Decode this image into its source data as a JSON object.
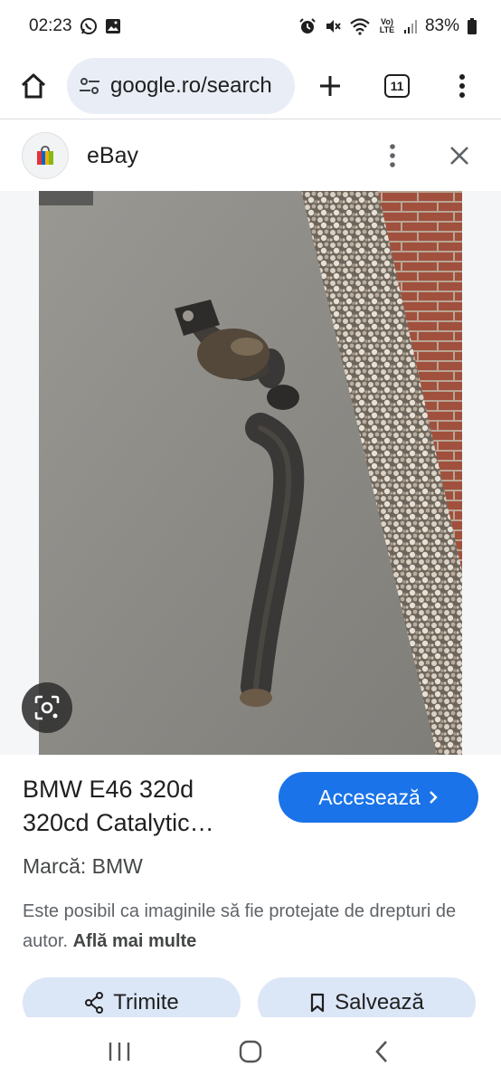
{
  "status_bar": {
    "time": "02:23",
    "battery": "83%",
    "net_label": "Vo) LTE"
  },
  "browser": {
    "url": "google.ro/search",
    "tab_count": "11"
  },
  "sheet": {
    "site_name": "eBay"
  },
  "product": {
    "title": "BMW E46 320d 320cd Catalytic…",
    "visit_label": "Accesează",
    "brand": "Marcă: BMW",
    "copyright_text": "Este posibil ca imaginile să fie protejate de drepturi de autor. ",
    "learn_more": "Află mai multe",
    "share_label": "Trimite",
    "save_label": "Salvează"
  },
  "colors": {
    "accent": "#1a73e8",
    "chip_bg": "#dbe6f7",
    "url_bg": "#e9edf5"
  },
  "icons": [
    "home-icon",
    "tune-icon",
    "plus-icon",
    "tabs-icon",
    "more-vert-icon",
    "ebay-bag-icon",
    "close-icon",
    "lens-icon",
    "share-icon",
    "bookmark-icon",
    "recents-icon",
    "home-circle-icon",
    "back-icon"
  ]
}
